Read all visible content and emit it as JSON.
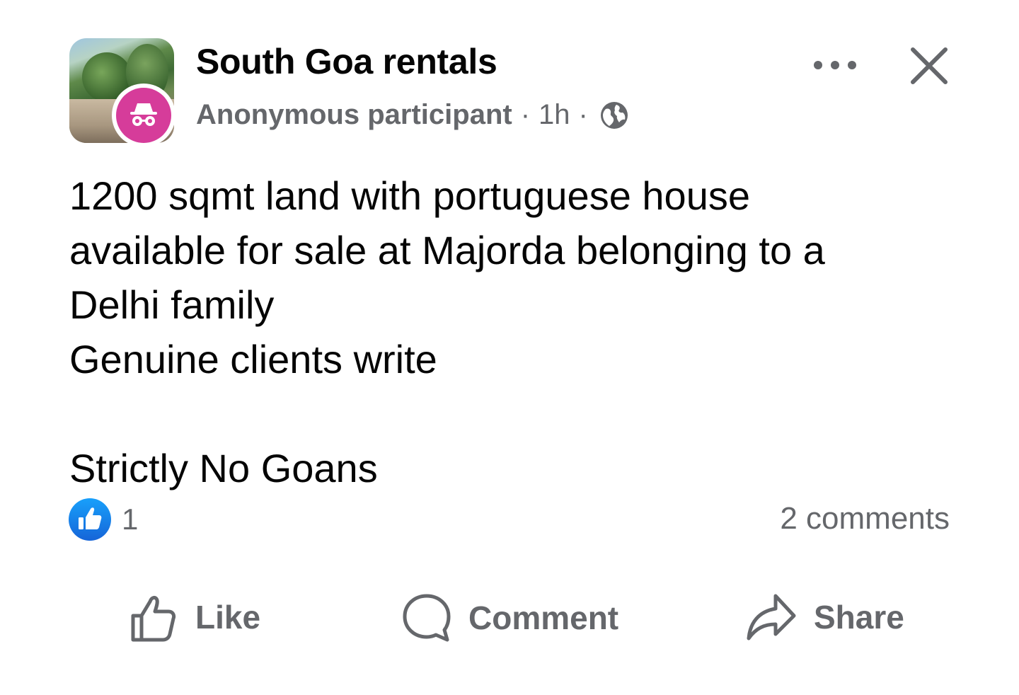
{
  "header": {
    "group_name": "South Goa rentals",
    "author": "Anonymous participant",
    "separator": "·",
    "time": "1h",
    "privacy_icon": "globe-icon",
    "more_icon": "more-options-icon",
    "close_icon": "close-icon"
  },
  "post": {
    "lines": [
      "1200 sqmt land with portuguese house",
      "available for sale at Majorda belonging to a",
      "Delhi family",
      "Genuine clients write",
      "",
      "Strictly No Goans"
    ]
  },
  "reactions": {
    "icon": "like-reaction-icon",
    "count": "1",
    "comments": "2 comments"
  },
  "actions": {
    "like": "Like",
    "comment": "Comment",
    "share": "Share"
  },
  "colors": {
    "text_primary": "#050505",
    "text_secondary": "#65676b",
    "like_blue": "#1877f2",
    "anon_pink": "#d63c9a"
  }
}
